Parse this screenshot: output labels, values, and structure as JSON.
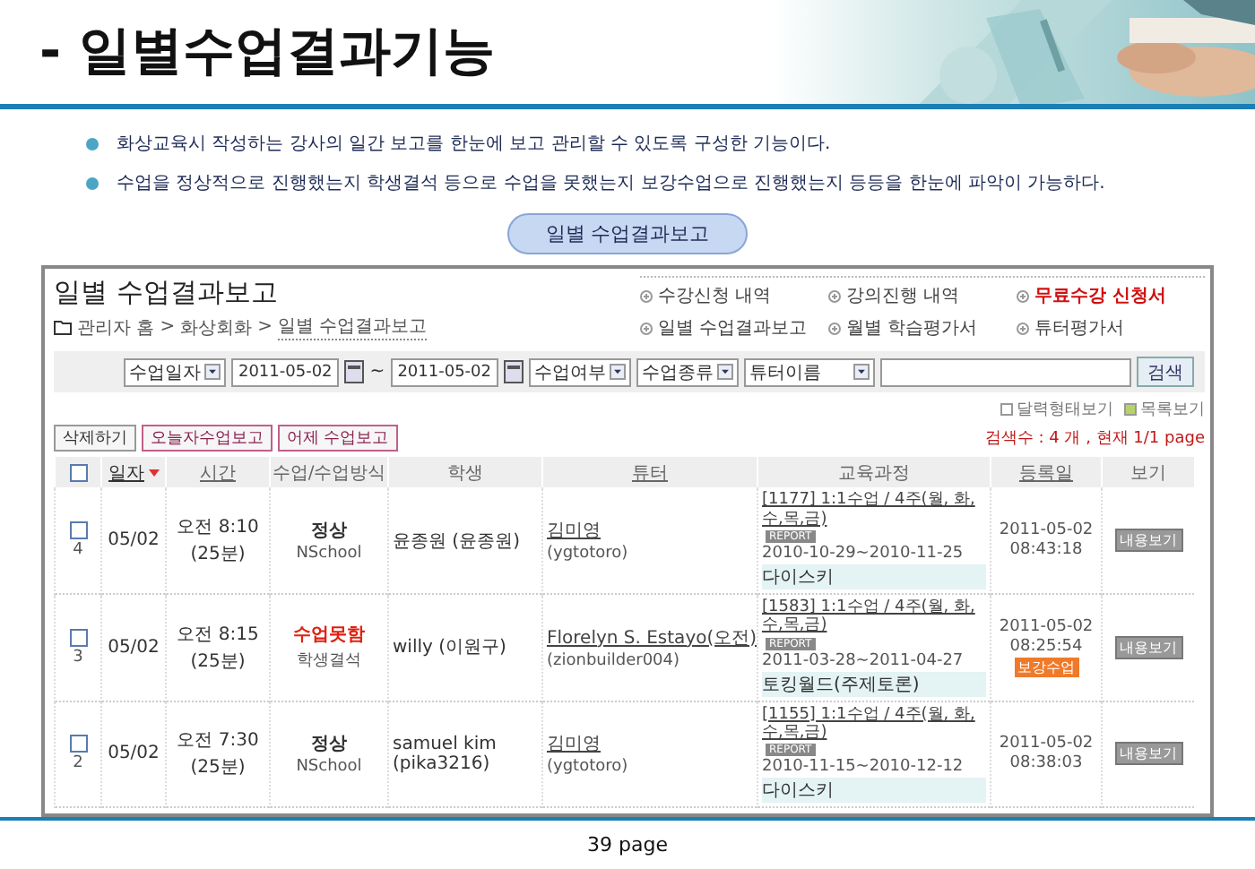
{
  "slide": {
    "title": "- 일별수업결과기능",
    "bullets": [
      "화상교육시 작성하는 강사의 일간 보고를 한눈에 보고 관리할 수 있도록 구성한 기능이다.",
      "수업을 정상적으로 진행했는지 학생결석 등으로 수업을 못했는지 보강수업으로 진행했는지 등등을 한눈에 파악이 가능하다."
    ],
    "caption": "일별 수업결과보고",
    "page": "39 page"
  },
  "app": {
    "title": "일별 수업결과보고",
    "breadcrumb": {
      "separator": ">",
      "items": [
        "관리자 홈",
        "화상회화",
        "일별 수업결과보고"
      ]
    },
    "quick_links": [
      {
        "label": "수강신청 내역",
        "highlight": false
      },
      {
        "label": "강의진행 내역",
        "highlight": false
      },
      {
        "label": "무료수강 신청서",
        "highlight": true
      },
      {
        "label": "일별 수업결과보고",
        "highlight": false
      },
      {
        "label": "월별 학습평가서",
        "highlight": false
      },
      {
        "label": "튜터평가서",
        "highlight": false
      }
    ],
    "filters": {
      "date_type": "수업일자",
      "start": "2011-05-02",
      "tilde": "~",
      "end": "2011-05-02",
      "status": "수업여부",
      "class_type": "수업종류",
      "search_by": "튜터이름",
      "search_button": "검색"
    },
    "view_toggles": [
      {
        "label": "달력형태보기",
        "selected": false
      },
      {
        "label": "목록보기",
        "selected": true
      }
    ],
    "actions": [
      {
        "label": "삭제하기",
        "kind": "plain"
      },
      {
        "label": "오늘자수업보고",
        "kind": "pink"
      },
      {
        "label": "어제 수업보고",
        "kind": "pink"
      }
    ],
    "result_count": "검색수 : 4 개 , 현재 1/1 page",
    "table": {
      "all_checked": false,
      "columns": [
        {
          "label": "일자",
          "link": true,
          "sorted": true
        },
        {
          "label": "시간",
          "link": true,
          "sorted": false
        },
        {
          "label": "수업/수업방식",
          "link": false,
          "sorted": false
        },
        {
          "label": "학생",
          "link": false,
          "sorted": false
        },
        {
          "label": "튜터",
          "link": true,
          "sorted": false
        },
        {
          "label": "교육과정",
          "link": false,
          "sorted": false
        },
        {
          "label": "등록일",
          "link": true,
          "sorted": false
        },
        {
          "label": "보기",
          "link": false,
          "sorted": false
        }
      ],
      "rows": [
        {
          "no": "4",
          "checked": false,
          "date": "05/02",
          "time": "오전 8:10",
          "duration": "(25분)",
          "status": "정상",
          "missed": false,
          "method": "NSchool",
          "student": "윤종원 (윤종원)",
          "tutor": "김미영",
          "tutor_id": "(ygtotoro)",
          "course": "[1177] 1:1수업 / 4주(월, 화,수,목,금)",
          "report": "REPORT",
          "period": "2010-10-29~2010-11-25",
          "book": "다이스키",
          "reg_date": "2011-05-02",
          "reg_time": "08:43:18",
          "view": "내용보기"
        },
        {
          "no": "3",
          "checked": false,
          "date": "05/02",
          "time": "오전 8:15",
          "duration": "(25분)",
          "status": "수업못함",
          "missed": true,
          "method": "학생결석",
          "student": "willy (이원구)",
          "tutor": "Florelyn S. Estayo(오전)",
          "tutor_id": "(zionbuilder004)",
          "course": "[1583] 1:1수업 / 4주(월, 화,수,목,금)",
          "report": "REPORT",
          "period": "2011-03-28~2011-04-27",
          "book": "토킹월드(주제토론)",
          "reg_date": "2011-05-02",
          "reg_time": "08:25:54",
          "badge": "보강수업",
          "view": "내용보기"
        },
        {
          "no": "2",
          "checked": false,
          "date": "05/02",
          "time": "오전 7:30",
          "duration": "(25분)",
          "status": "정상",
          "missed": false,
          "method": "NSchool",
          "student": "samuel kim (pika3216)",
          "tutor": "김미영",
          "tutor_id": "(ygtotoro)",
          "course": "[1155] 1:1수업 / 4주(월, 화,수,목,금)",
          "report": "REPORT",
          "period": "2010-11-15~2010-12-12",
          "book": "다이스키",
          "reg_date": "2011-05-02",
          "reg_time": "08:38:03",
          "view": "내용보기"
        }
      ]
    }
  }
}
